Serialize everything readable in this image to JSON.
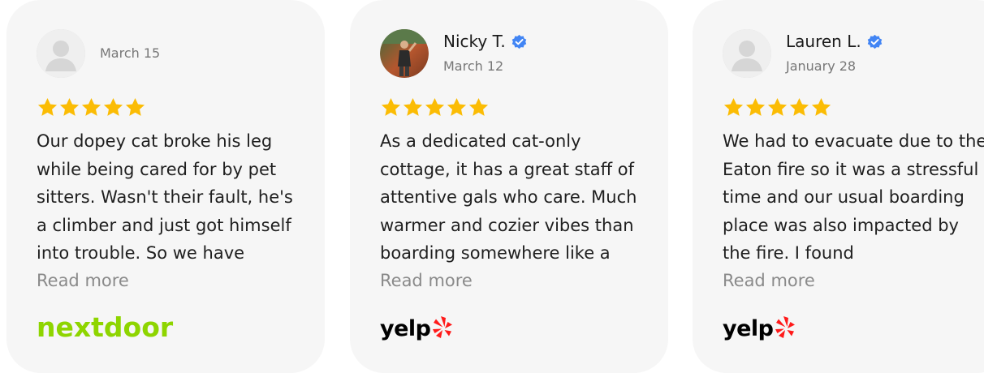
{
  "reviews": [
    {
      "name": "",
      "verified": false,
      "date": "March 15",
      "rating": 5,
      "text": "Our dopey cat broke his leg while being cared for by pet sitters. Wasn't their fault, he's a climber and just got himself into trouble. So we have",
      "read_more": "Read more",
      "source": "nextdoor",
      "source_logo_text": "nextdoor"
    },
    {
      "name": "Nicky T.",
      "verified": true,
      "date": "March 12",
      "rating": 5,
      "text": "As a dedicated cat-only cottage, it has a great staff of attentive gals who care. Much warmer and cozier vibes than boarding somewhere like a",
      "read_more": "Read more",
      "source": "yelp",
      "source_logo_text": "yelp"
    },
    {
      "name": "Lauren L.",
      "verified": true,
      "date": "January 28",
      "rating": 5,
      "text": "We had to evacuate due to the Eaton fire so it was a stressful time and our usual boarding place was also impacted by the fire. I found",
      "read_more": "Read more",
      "source": "yelp",
      "source_logo_text": "yelp"
    }
  ],
  "colors": {
    "card_bg": "#f6f6f6",
    "star": "#fbbc04",
    "verified": "#4285f4",
    "nextdoor": "#8ed500",
    "yelp_burst": "#ff1a1a",
    "read_more": "#8a8a8a"
  },
  "icons": {
    "avatar_placeholder": "user-silhouette-icon",
    "verified": "verified-badge-icon",
    "star": "star-icon",
    "yelp_burst": "yelp-burst-icon"
  }
}
